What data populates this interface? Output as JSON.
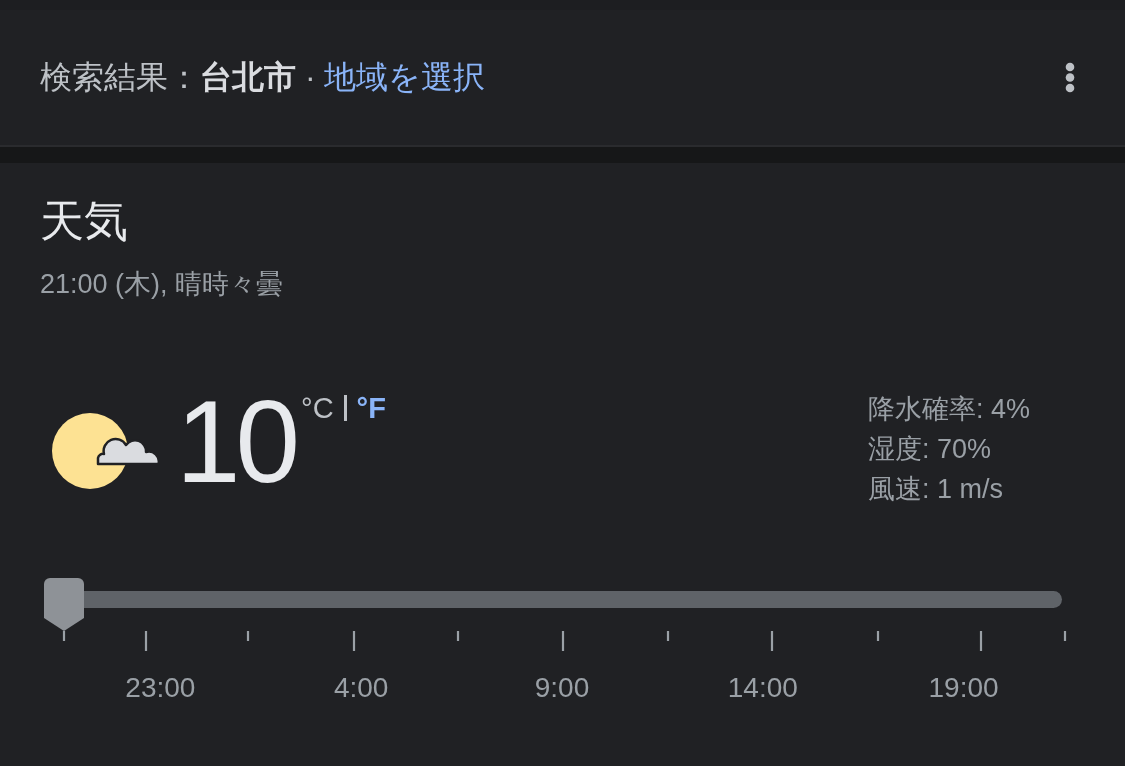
{
  "header": {
    "label": "検索結果：**台北市** ·",
    "link": "地域を選択"
  },
  "weather": {
    "title": "天気",
    "subtitle": "21:00 (木), 晴時々曇",
    "temperature": "10",
    "units": [
      {
        "label": "°C",
        "selected": true
      },
      {
        "label": "°F",
        "selected": false
      }
    ],
    "details": [
      "降水確率: 4%",
      "湿度: 70%",
      "風速: 1 m/s"
    ]
  },
  "timeline": {
    "level": 0,
    "labels": [
      "23:00",
      "4:00",
      "9:00",
      "14:00",
      "19:00"
    ]
  }
}
